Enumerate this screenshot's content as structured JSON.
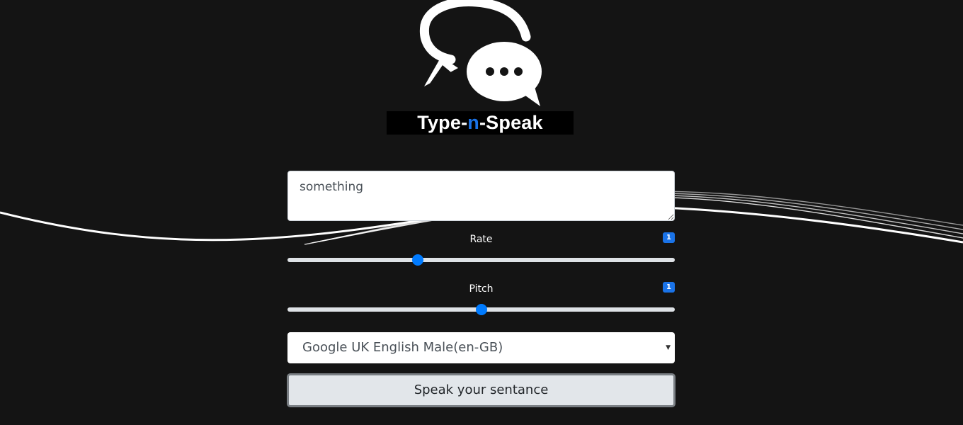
{
  "brand": {
    "title_part1": "Type-",
    "title_accent": "n",
    "title_part2": "-Speak"
  },
  "icons": {
    "logo": "chat-bubbles-icon",
    "select_caret": "caret-down-icon"
  },
  "text_input": {
    "value": "something"
  },
  "rate": {
    "label": "Rate",
    "badge": "1",
    "level_percent": 33.7
  },
  "pitch": {
    "label": "Pitch",
    "badge": "1",
    "level_percent": 50
  },
  "voice_select": {
    "selected": "Google UK English Male(en-GB)"
  },
  "speak_button": {
    "label": "Speak your sentance"
  },
  "colors": {
    "background": "#141414",
    "accent": "#1a73e8",
    "slider_thumb": "#007bff"
  }
}
